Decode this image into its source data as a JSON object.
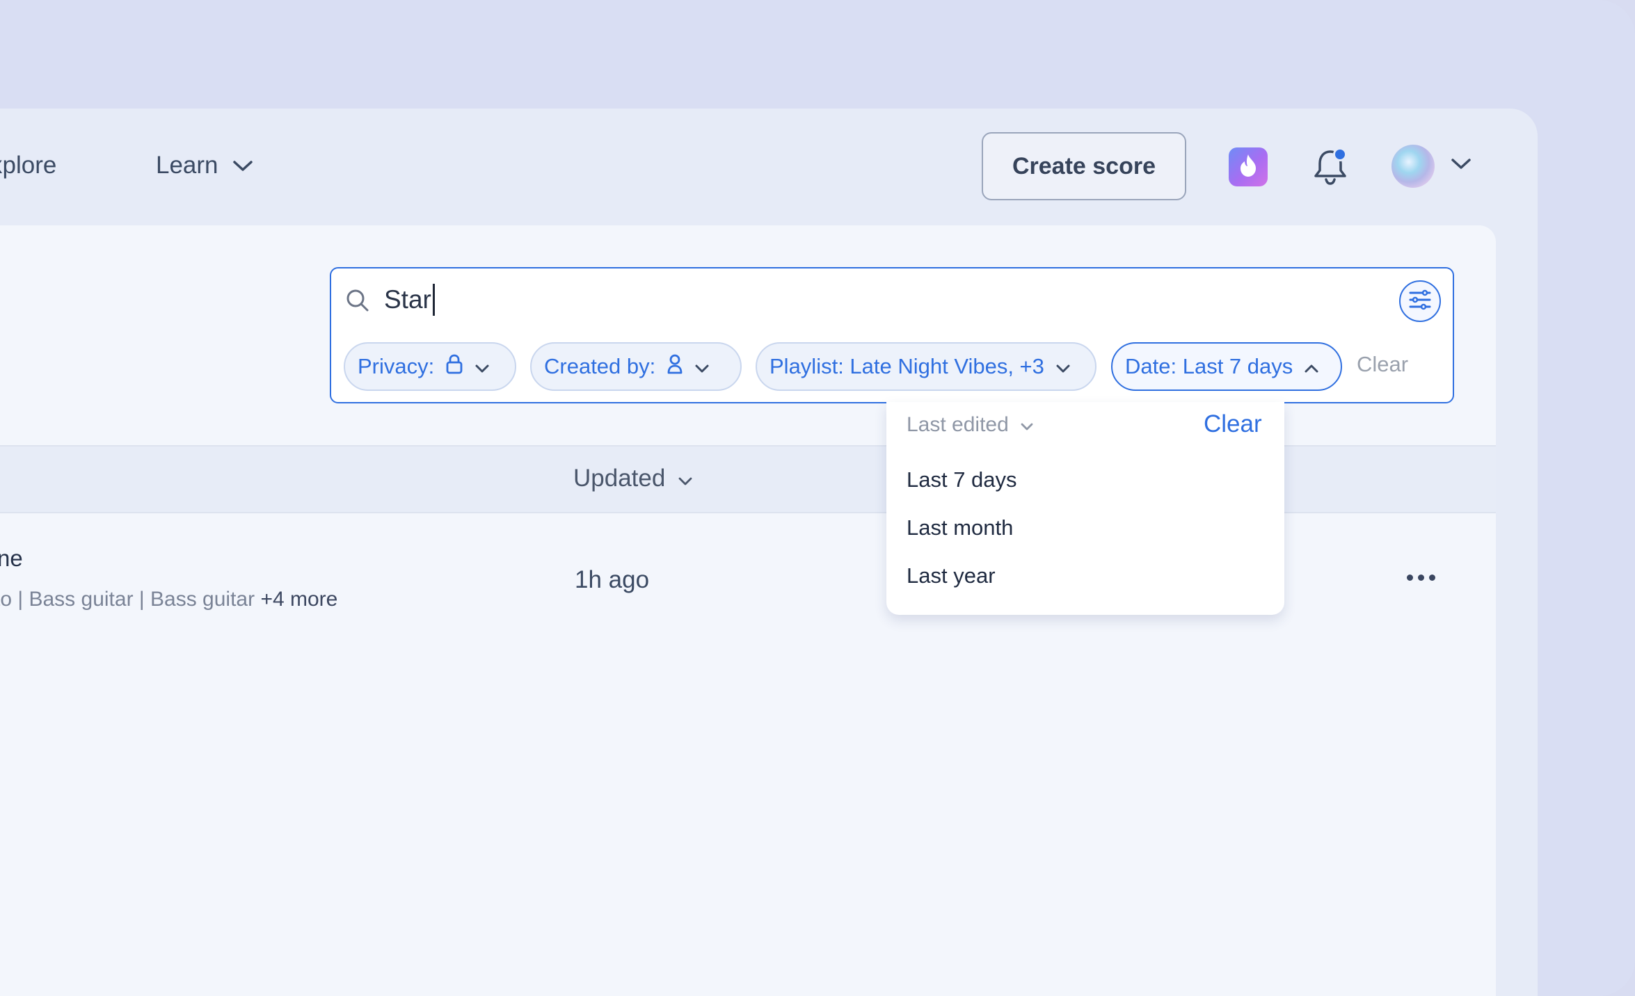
{
  "nav": {
    "explore_label": "xplore",
    "learn_label": "Learn",
    "create_label": "Create score"
  },
  "search": {
    "value": "Star"
  },
  "chips": {
    "privacy_label": "Privacy:",
    "created_label": "Created by:",
    "playlist_label": "Playlist: Late Night Vibes, +3",
    "date_label": "Date: Last 7 days",
    "clear_label": "Clear"
  },
  "table": {
    "updated_header": "Updated",
    "row": {
      "title": "ne",
      "subtitle": "to | Bass guitar | Bass guitar",
      "more": "+4 more",
      "updated": "1h ago"
    }
  },
  "dropdown": {
    "sort_label": "Last edited",
    "clear_label": "Clear",
    "options": [
      "Last 7 days",
      "Last month",
      "Last year"
    ]
  },
  "colors": {
    "accent": "#2f6fe0",
    "background": "#d9def3",
    "panel": "#f3f6fc",
    "notification_dot": "#2f6fe0"
  },
  "icons": [
    "chevron-down-icon",
    "flame-icon",
    "bell-icon",
    "search-icon",
    "filter-sliders-icon",
    "lock-icon",
    "person-icon",
    "chevron-up-icon",
    "more-horizontal-icon"
  ]
}
